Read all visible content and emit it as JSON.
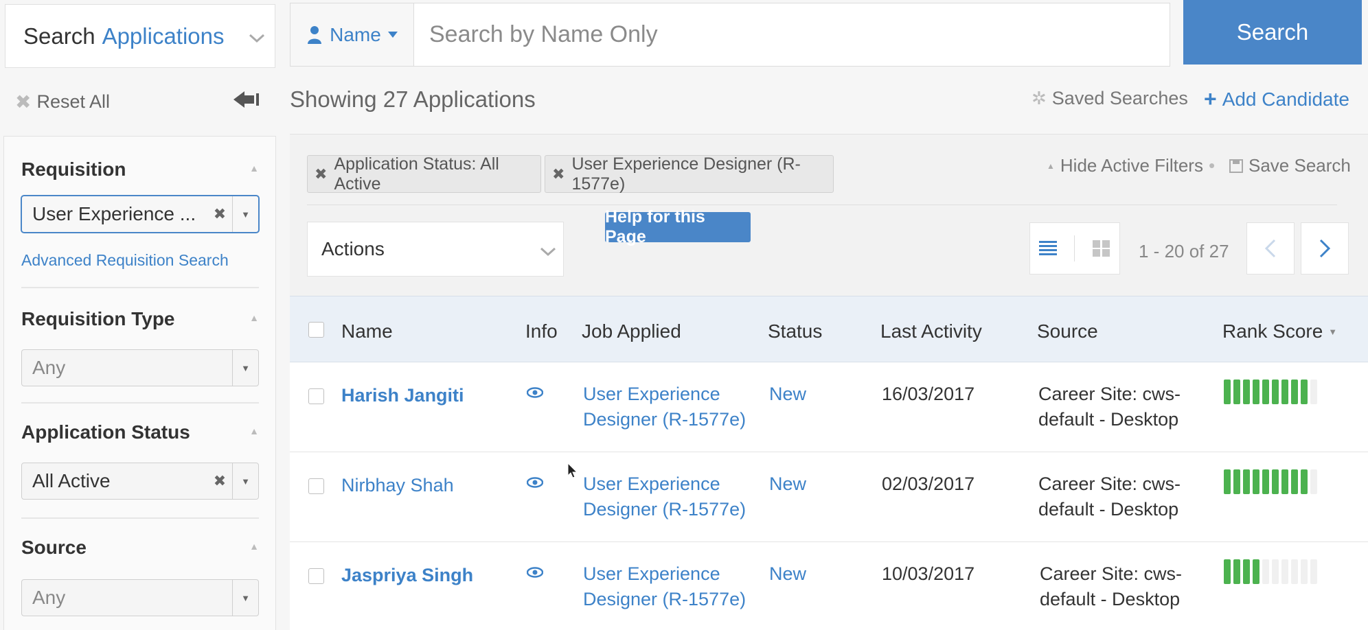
{
  "topbar": {
    "search_type_prefix": "Search",
    "search_type_accent": "Applications",
    "scope_label": "Name",
    "search_placeholder": "Search by Name Only",
    "search_button": "Search"
  },
  "toolbar": {
    "reset_all": "Reset All",
    "showing": "Showing 27 Applications",
    "saved_searches": "Saved Searches",
    "add_candidate": "Add Candidate"
  },
  "sidebar": {
    "requisition": {
      "title": "Requisition",
      "value": "User Experience ...",
      "advanced_link": "Advanced Requisition Search"
    },
    "requisition_type": {
      "title": "Requisition Type",
      "value": "Any"
    },
    "application_status": {
      "title": "Application Status",
      "value": "All Active"
    },
    "source": {
      "title": "Source",
      "value": "Any"
    }
  },
  "filters": {
    "chips": [
      "Application Status: All Active",
      "User Experience Designer (R-1577e)"
    ],
    "hide_active_filters": "Hide Active Filters",
    "save_search": "Save Search"
  },
  "list_controls": {
    "actions": "Actions",
    "help": "Help for this Page",
    "range": "1 - 20 of 27"
  },
  "table": {
    "columns": [
      "Name",
      "Info",
      "Job Applied",
      "Status",
      "Last Activity",
      "Source",
      "Rank Score"
    ],
    "rows": [
      {
        "name": "Harish Jangiti",
        "job_line1": "User Experience",
        "job_line2": "Designer (R-1577e)",
        "status": "New",
        "last_activity": "16/03/2017",
        "source_line1": "Career Site: cws-",
        "source_line2": "default - Desktop",
        "rank_score": 9
      },
      {
        "name": "Nirbhay Shah",
        "job_line1": "User Experience",
        "job_line2": "Designer (R-1577e)",
        "status": "New",
        "last_activity": "02/03/2017",
        "source_line1": "Career Site: cws-",
        "source_line2": "default - Desktop",
        "rank_score": 9
      },
      {
        "name": "Jaspriya Singh",
        "job_line1": "User Experience",
        "job_line2": "Designer (R-1577e)",
        "status": "New",
        "last_activity": "10/03/2017",
        "source_line1": "Career Site: cws-",
        "source_line2": "default - Desktop",
        "rank_score": 4
      }
    ],
    "rank_score_max": 10
  },
  "colors": {
    "accent": "#3d82c8",
    "button": "#4a86c8",
    "score_on": "#4cb24f",
    "header_bg": "#eaf0f7"
  },
  "icons": [
    "chevron-down-icon",
    "user-icon",
    "close-icon",
    "collapse-left-icon",
    "gear-icon",
    "plus-icon",
    "list-view-icon",
    "grid-view-icon",
    "chevron-left-icon",
    "chevron-right-icon",
    "eye-icon",
    "sort-desc-icon",
    "checkbox-icon"
  ]
}
